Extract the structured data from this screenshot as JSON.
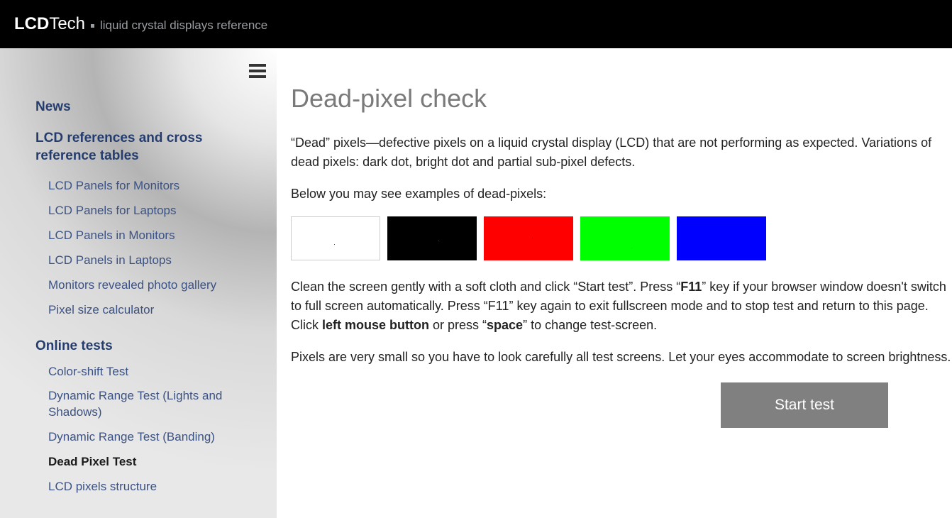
{
  "header": {
    "logo_lcd": "LCD",
    "logo_tech": "Tech",
    "tagline": "liquid crystal displays reference"
  },
  "sidebar": {
    "top_links": [
      {
        "label": "News"
      },
      {
        "label": "LCD references and cross reference tables"
      }
    ],
    "ref_links": [
      {
        "label": "LCD Panels for Monitors"
      },
      {
        "label": "LCD Panels for Laptops"
      },
      {
        "label": "LCD Panels in Monitors"
      },
      {
        "label": "LCD Panels in Laptops"
      },
      {
        "label": "Monitors revealed photo gallery"
      },
      {
        "label": "Pixel size calculator"
      }
    ],
    "tests_heading": "Online tests",
    "test_links": [
      {
        "label": "Color-shift Test",
        "active": false
      },
      {
        "label": "Dynamic Range Test (Lights and Shadows)",
        "active": false
      },
      {
        "label": "Dynamic Range Test (Banding)",
        "active": false
      },
      {
        "label": "Dead Pixel Test",
        "active": true
      },
      {
        "label": "LCD pixels structure",
        "active": false
      }
    ]
  },
  "main": {
    "title": "Dead-pixel check",
    "intro": "“Dead” pixels—defective pixels on a liquid crystal display (LCD) that are not performing as expected. Variations of dead pixels: dark dot, bright dot and partial sub-pixel defects.",
    "examples_lead": "Below you may see examples of dead-pixels:",
    "swatches": [
      {
        "color": "white"
      },
      {
        "color": "black"
      },
      {
        "color": "red"
      },
      {
        "color": "green"
      },
      {
        "color": "blue"
      }
    ],
    "instructions_pre": "Clean the screen gently with a soft cloth and click “Start test”. Press “",
    "instructions_f11": "F11",
    "instructions_mid": "” key if your browser window doesn't switch to full screen automatically. Press “F11” key again to exit fullscreen mode and to stop test and return to this page. Click ",
    "instructions_lmb": "left mouse button",
    "instructions_or": " or press “",
    "instructions_space": "space",
    "instructions_end": "” to change test-screen.",
    "tip": "Pixels are very small so you have to look carefully all test screens. Let your eyes accommodate to screen brightness.",
    "start_button": "Start test"
  }
}
